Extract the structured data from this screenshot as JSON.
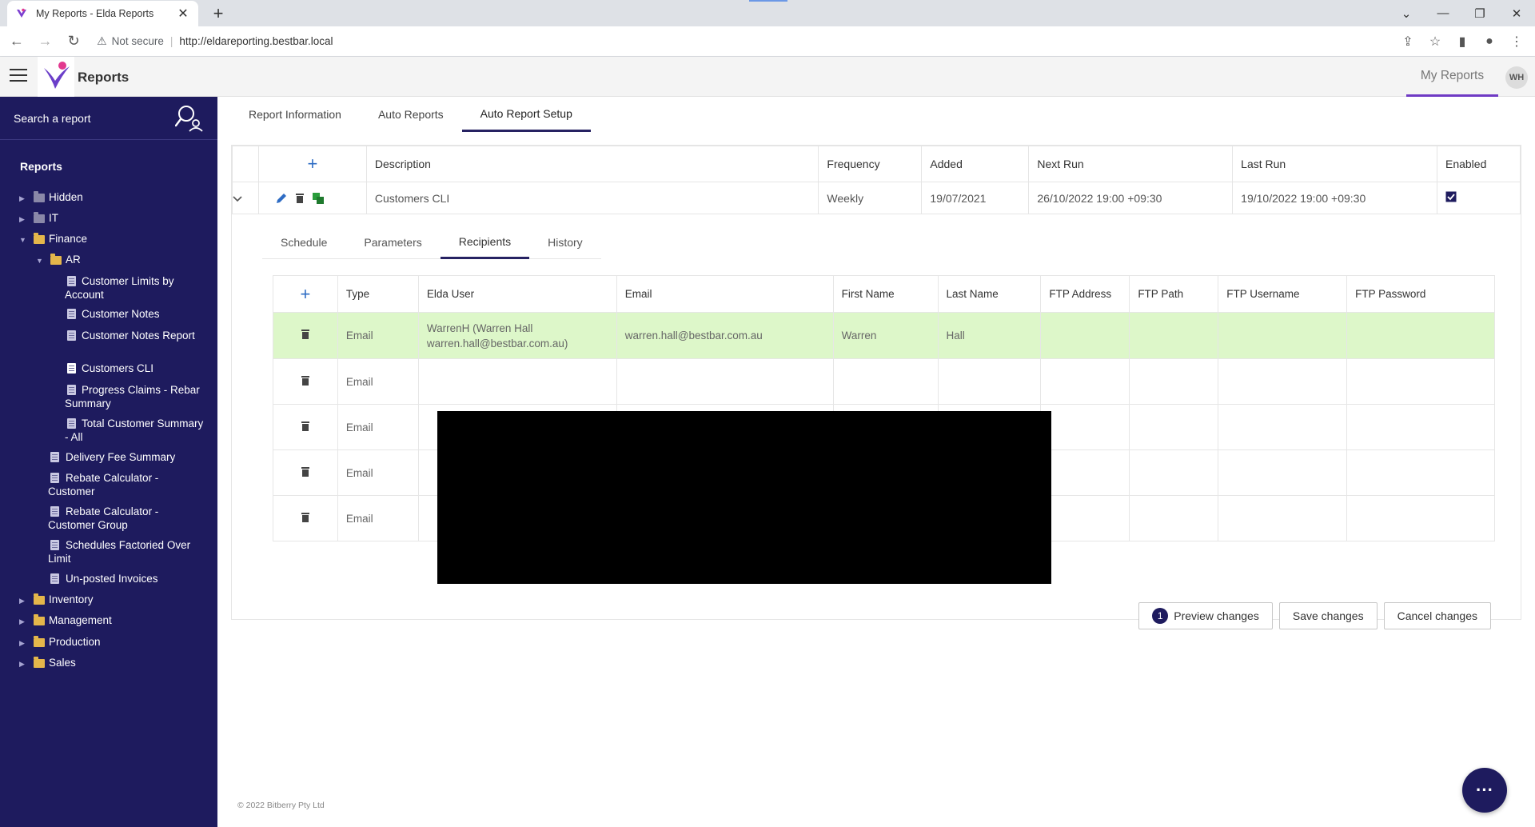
{
  "browser": {
    "tab_title": "My Reports - Elda Reports",
    "security_label": "Not secure",
    "url": "http://eldareporting.bestbar.local"
  },
  "header": {
    "app_title": "Reports",
    "nav_link": "My Reports",
    "user_initials": "WH",
    "accent_color": "#6f3ac4"
  },
  "sidebar": {
    "search_label": "Search a report",
    "heading": "Reports",
    "tree": [
      {
        "label": "Hidden",
        "kind": "folder",
        "expanded": false
      },
      {
        "label": "IT",
        "kind": "folder",
        "expanded": false
      },
      {
        "label": "Finance",
        "kind": "folder",
        "expanded": true
      },
      {
        "label": "AR",
        "kind": "folder",
        "expanded": true
      },
      {
        "label": "Customer Limits by Account",
        "kind": "report"
      },
      {
        "label": "Customer Notes",
        "kind": "report"
      },
      {
        "label": "Customer Notes Report",
        "kind": "report"
      },
      {
        "label": "Customers CLI",
        "kind": "report",
        "selected": true
      },
      {
        "label": "Progress Claims - Rebar Summary",
        "kind": "report"
      },
      {
        "label": "Total Customer Summary - All",
        "kind": "report"
      },
      {
        "label": "Delivery Fee Summary",
        "kind": "report"
      },
      {
        "label": "Rebate Calculator - Customer",
        "kind": "report"
      },
      {
        "label": "Rebate Calculator - Customer Group",
        "kind": "report"
      },
      {
        "label": "Schedules Factoried Over Limit",
        "kind": "report"
      },
      {
        "label": "Un-posted Invoices",
        "kind": "report"
      },
      {
        "label": "Inventory",
        "kind": "folder",
        "expanded": false
      },
      {
        "label": "Management",
        "kind": "folder",
        "expanded": false
      },
      {
        "label": "Production",
        "kind": "folder",
        "expanded": false
      },
      {
        "label": "Sales",
        "kind": "folder",
        "expanded": false
      }
    ],
    "bg_color": "#1e1b5e"
  },
  "main": {
    "tabs": [
      "Report Information",
      "Auto Reports",
      "Auto Report Setup"
    ],
    "active_tab": "Auto Report Setup",
    "auto_reports": {
      "headers": [
        "Description",
        "Frequency",
        "Added",
        "Next Run",
        "Last Run",
        "Enabled"
      ],
      "rows": [
        {
          "description": "Customers CLI",
          "frequency": "Weekly",
          "added": "19/07/2021",
          "next_run": "26/10/2022 19:00 +09:30",
          "last_run": "19/10/2022 19:00 +09:30",
          "enabled": true
        }
      ]
    },
    "sub_tabs": [
      "Schedule",
      "Parameters",
      "Recipients",
      "History"
    ],
    "active_sub_tab": "Recipients",
    "recipients": {
      "headers": [
        "Type",
        "Elda User",
        "Email",
        "First Name",
        "Last Name",
        "FTP Address",
        "FTP Path",
        "FTP Username",
        "FTP Password"
      ],
      "rows": [
        {
          "type": "Email",
          "elda_user": "WarrenH (Warren Hall warren.hall@bestbar.com.au)",
          "email": "warren.hall@bestbar.com.au",
          "first_name": "Warren",
          "last_name": "Hall",
          "selected": true
        },
        {
          "type": "Email"
        },
        {
          "type": "Email"
        },
        {
          "type": "Email"
        },
        {
          "type": "Email"
        }
      ]
    },
    "buttons": {
      "preview_count": "1",
      "preview": "Preview changes",
      "save": "Save changes",
      "cancel": "Cancel changes"
    },
    "footer": "© 2022 Bitberry Pty Ltd"
  }
}
